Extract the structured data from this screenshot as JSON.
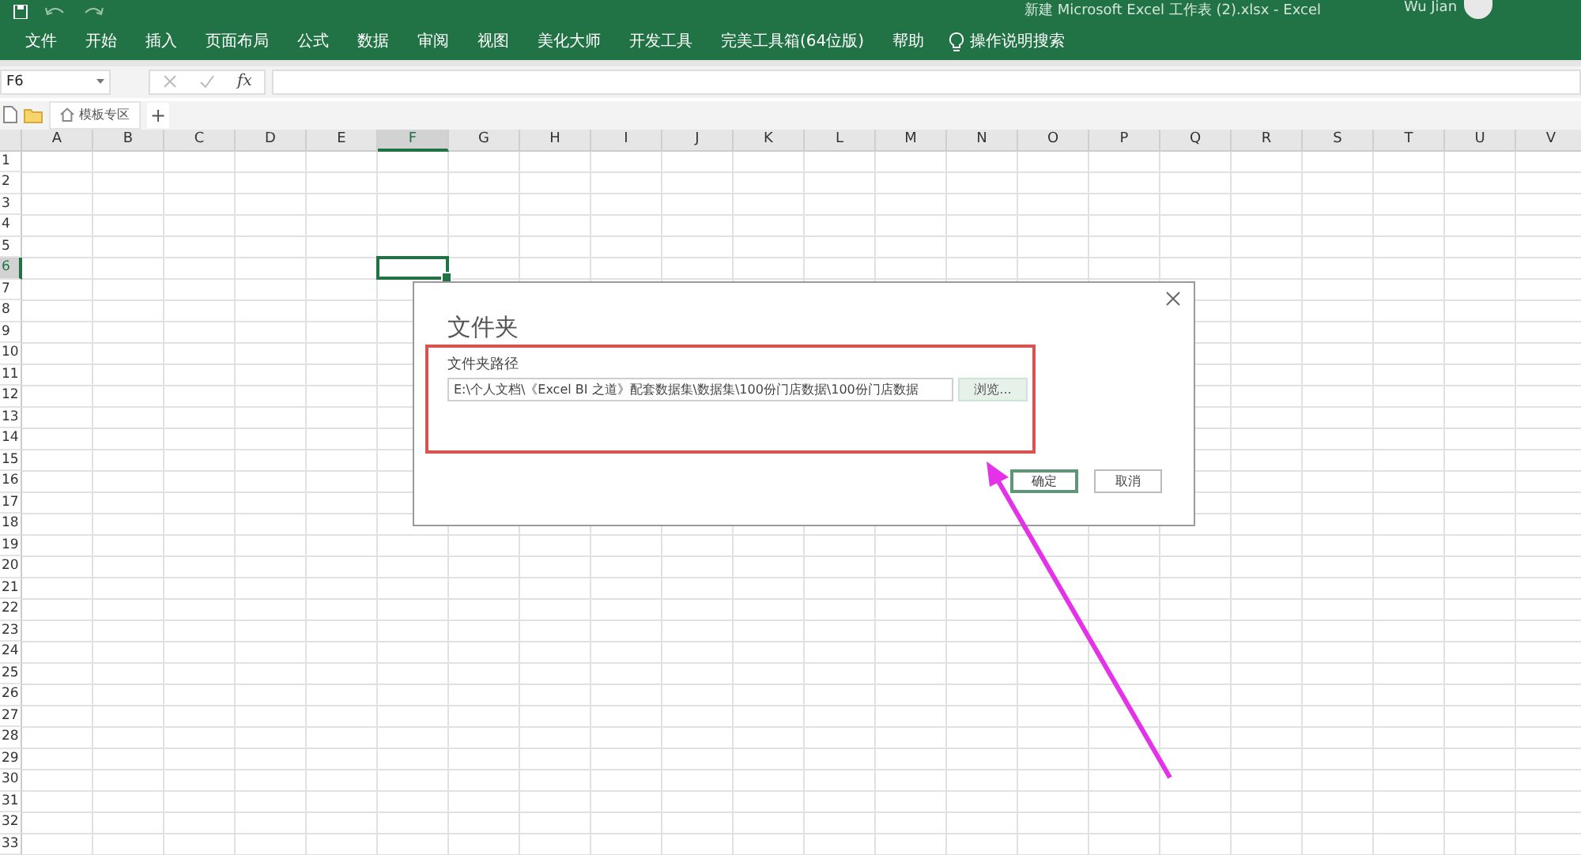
{
  "window": {
    "title": "新建 Microsoft Excel 工作表 (2).xlsx  -  Excel",
    "user": "Wu Jian"
  },
  "ribbon": {
    "tabs": [
      "文件",
      "开始",
      "插入",
      "页面布局",
      "公式",
      "数据",
      "审阅",
      "视图",
      "美化大师",
      "开发工具",
      "完美工具箱(64位版)",
      "帮助"
    ],
    "search": "操作说明搜索"
  },
  "formula_bar": {
    "name_box": "F6",
    "fx": "fx"
  },
  "sheet_tabs": {
    "tab": "模板专区",
    "add": "+"
  },
  "sheet": {
    "columns": [
      {
        "label": "A",
        "selected": false
      },
      {
        "label": "B",
        "selected": false
      },
      {
        "label": "C",
        "selected": false
      },
      {
        "label": "D",
        "selected": false
      },
      {
        "label": "E",
        "selected": false
      },
      {
        "label": "F",
        "selected": true
      },
      {
        "label": "G",
        "selected": false
      },
      {
        "label": "H",
        "selected": false
      },
      {
        "label": "I",
        "selected": false
      },
      {
        "label": "J",
        "selected": false
      },
      {
        "label": "K",
        "selected": false
      },
      {
        "label": "L",
        "selected": false
      },
      {
        "label": "M",
        "selected": false
      },
      {
        "label": "N",
        "selected": false
      },
      {
        "label": "O",
        "selected": false
      },
      {
        "label": "P",
        "selected": false
      },
      {
        "label": "Q",
        "selected": false
      },
      {
        "label": "R",
        "selected": false
      },
      {
        "label": "S",
        "selected": false
      },
      {
        "label": "T",
        "selected": false
      },
      {
        "label": "U",
        "selected": false
      },
      {
        "label": "V",
        "selected": false
      }
    ],
    "rows": [
      {
        "label": "1",
        "selected": false
      },
      {
        "label": "2",
        "selected": false
      },
      {
        "label": "3",
        "selected": false
      },
      {
        "label": "4",
        "selected": false
      },
      {
        "label": "5",
        "selected": false
      },
      {
        "label": "6",
        "selected": true
      },
      {
        "label": "7",
        "selected": false
      },
      {
        "label": "8",
        "selected": false
      },
      {
        "label": "9",
        "selected": false
      },
      {
        "label": "10",
        "selected": false
      },
      {
        "label": "11",
        "selected": false
      },
      {
        "label": "12",
        "selected": false
      },
      {
        "label": "13",
        "selected": false
      },
      {
        "label": "14",
        "selected": false
      },
      {
        "label": "15",
        "selected": false
      },
      {
        "label": "16",
        "selected": false
      },
      {
        "label": "17",
        "selected": false
      },
      {
        "label": "18",
        "selected": false
      },
      {
        "label": "19",
        "selected": false
      },
      {
        "label": "20",
        "selected": false
      },
      {
        "label": "21",
        "selected": false
      },
      {
        "label": "22",
        "selected": false
      },
      {
        "label": "23",
        "selected": false
      },
      {
        "label": "24",
        "selected": false
      },
      {
        "label": "25",
        "selected": false
      },
      {
        "label": "26",
        "selected": false
      },
      {
        "label": "27",
        "selected": false
      },
      {
        "label": "28",
        "selected": false
      },
      {
        "label": "29",
        "selected": false
      },
      {
        "label": "30",
        "selected": false
      },
      {
        "label": "31",
        "selected": false
      },
      {
        "label": "32",
        "selected": false
      },
      {
        "label": "33",
        "selected": false
      }
    ]
  },
  "dialog": {
    "title": "文件夹",
    "field_label": "文件夹路径",
    "path": "E:\\个人文档\\《Excel BI 之道》配套数据集\\数据集\\100份门店数据\\100份门店数据",
    "browse": "浏览...",
    "ok": "确定",
    "cancel": "取消"
  }
}
